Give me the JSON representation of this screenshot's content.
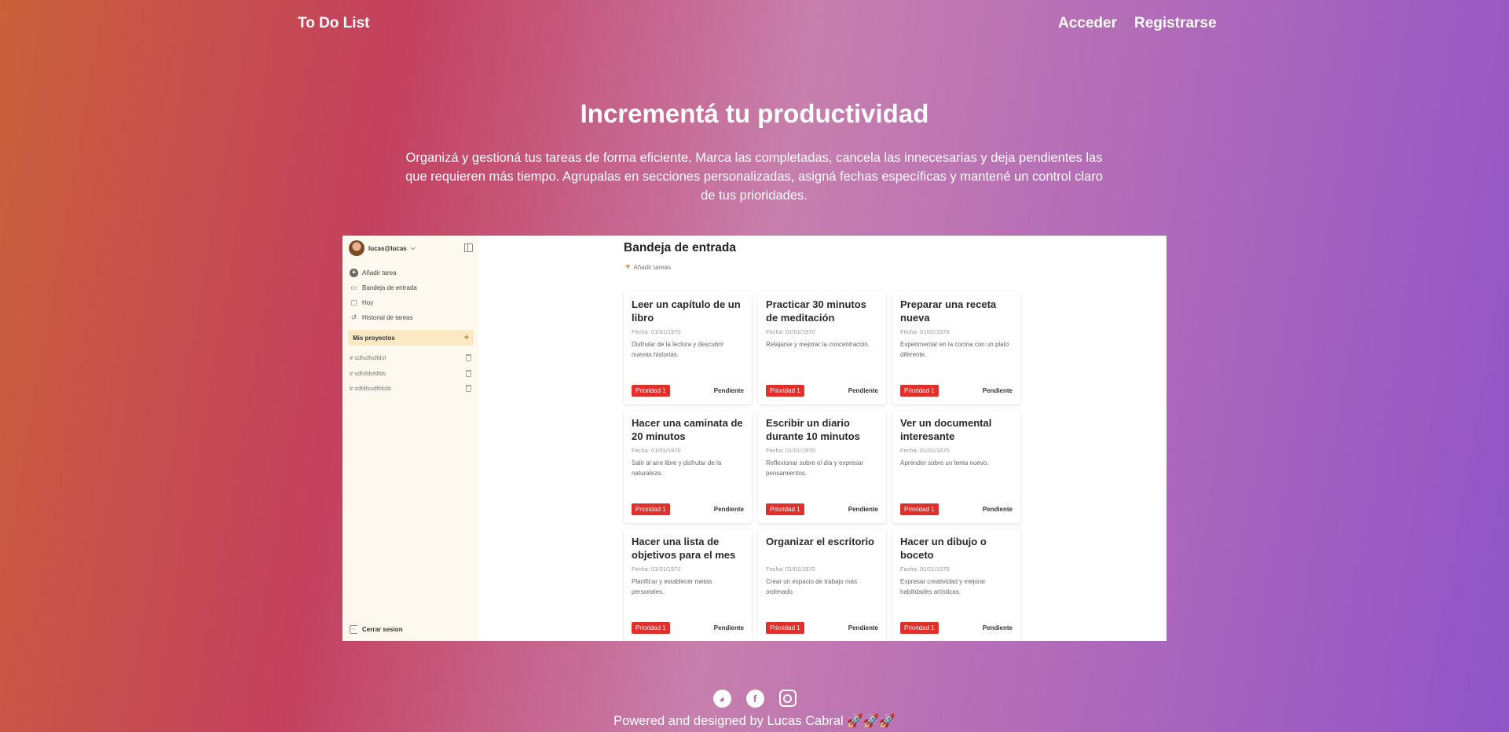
{
  "nav": {
    "brand": "To Do List",
    "login": "Acceder",
    "register": "Registrarse"
  },
  "hero": {
    "title": "Incrementá tu productividad",
    "description": "Organizá y gestioná tus tareas de forma eficiente. Marca las completadas, cancela las innecesarias y deja pendientes las que requieren más tiempo. Agrupalas en secciones personalizadas, asigná fechas específicas y mantené un control claro de tus prioridades."
  },
  "preview": {
    "user": "lucas@lucas",
    "menu": [
      "Añadir tarea",
      "Bandeja de entrada",
      "Hoy",
      "Historial de tareas"
    ],
    "projects_title": "Mis proyectos",
    "projects": [
      "sdfsdfsdfdsf",
      "sdfsfdsfdfds",
      "sdfdfssdffdsfd"
    ],
    "logout": "Cerrar sesion",
    "main_title": "Bandeja de entrada",
    "add_task": "Añadir tareas",
    "tasks": [
      {
        "title": "Leer un capítulo de un libro",
        "date": "Fecha: 01/01/1970",
        "desc": "Disfrutar de la lectura y descubrir nuevas historias.",
        "priority": "Prioridad 1",
        "status": "Pendiente"
      },
      {
        "title": "Practicar 30 minutos de meditación",
        "date": "Fecha: 01/01/1970",
        "desc": "Relajarse y mejorar la concentración.",
        "priority": "Prioridad 1",
        "status": "Pendiente"
      },
      {
        "title": "Preparar una receta nueva",
        "date": "Fecha: 01/01/1970",
        "desc": "Experimentar en la cocina con un plato diferente.",
        "priority": "Prioridad 1",
        "status": "Pendiente"
      },
      {
        "title": "Hacer una caminata de 20 minutos",
        "date": "Fecha: 01/01/1970",
        "desc": "Salir al aire libre y disfrutar de la naturaleza.",
        "priority": "Prioridad 1",
        "status": "Pendiente"
      },
      {
        "title": "Escribir un diario durante 10 minutos",
        "date": "Fecha: 01/01/1970",
        "desc": "Reflexionar sobre el día y expresar pensamientos.",
        "priority": "Prioridad 1",
        "status": "Pendiente"
      },
      {
        "title": "Ver un documental interesante",
        "date": "Fecha: 01/01/1970",
        "desc": "Aprender sobre un tema nuevo.",
        "priority": "Prioridad 1",
        "status": "Pendiente"
      },
      {
        "title": "Hacer una lista de objetivos para el mes",
        "date": "Fecha: 01/01/1970",
        "desc": "Planificar y establecer metas personales.",
        "priority": "Prioridad 1",
        "status": "Pendiente"
      },
      {
        "title": "Organizar el escritorio",
        "date": "Fecha: 01/01/1970",
        "desc": "Crear un espacio de trabajo más ordenado.",
        "priority": "Prioridad 1",
        "status": "Pendiente"
      },
      {
        "title": "Hacer un dibujo o boceto",
        "date": "Fecha: 01/01/1970",
        "desc": "Expresar creatividad y mejorar habilidades artísticas.",
        "priority": "Prioridad 1",
        "status": "Pendiente"
      }
    ]
  },
  "social_icons": [
    "github-icon",
    "facebook-icon",
    "instagram-icon"
  ],
  "footer": {
    "text": "Powered and designed by Lucas Cabral 🚀🚀🚀"
  },
  "colors": {
    "priority": "#e0302c",
    "gradient_start": "#c9613a",
    "gradient_end": "#8f55c8"
  }
}
